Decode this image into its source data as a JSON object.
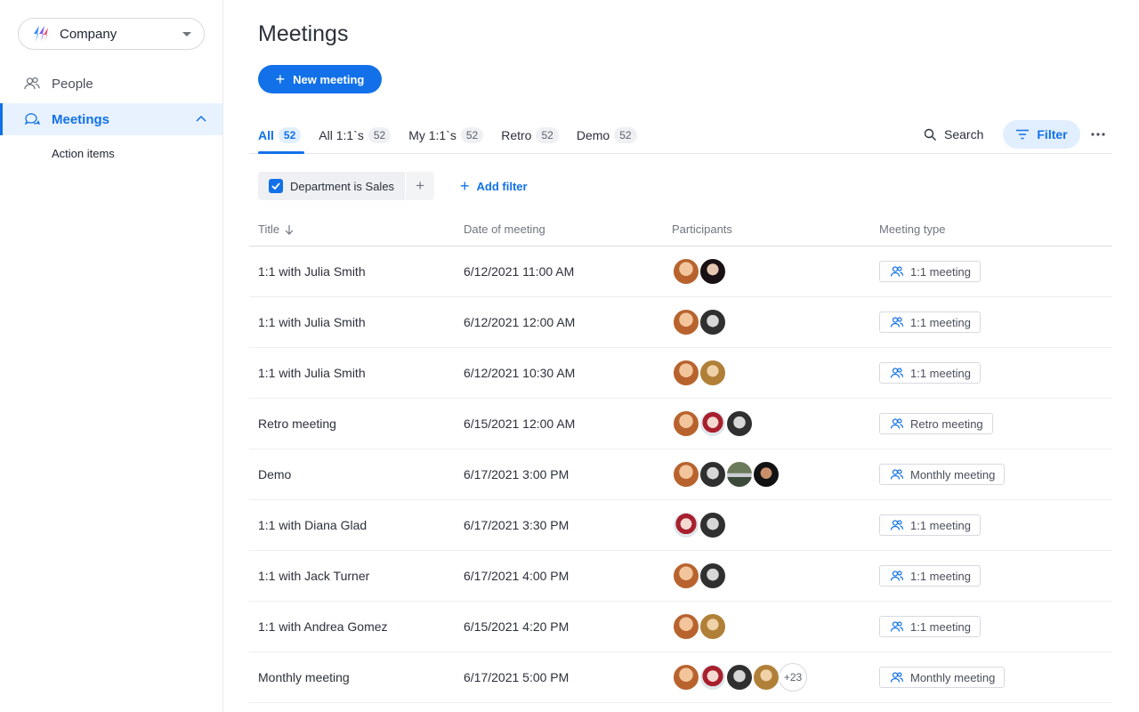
{
  "sidebar": {
    "company": "Company",
    "items": [
      {
        "label": "People",
        "icon": "people-icon"
      },
      {
        "label": "Meetings",
        "icon": "chat-bubbles-icon"
      }
    ],
    "sub_items": [
      {
        "label": "Action items"
      }
    ]
  },
  "header": {
    "title": "Meetings",
    "new_button": "New meeting"
  },
  "tabs": [
    {
      "label": "All",
      "count": "52"
    },
    {
      "label": "All 1:1`s",
      "count": "52"
    },
    {
      "label": "My 1:1`s",
      "count": "52"
    },
    {
      "label": "Retro",
      "count": "52"
    },
    {
      "label": "Demo",
      "count": "52"
    }
  ],
  "toolbar": {
    "search_label": "Search",
    "filter_label": "Filter"
  },
  "filters": {
    "active_chip": "Department is Sales",
    "add_filter": "Add filter"
  },
  "table": {
    "columns": [
      "Title",
      "Date of meeting",
      "Participants",
      "Meeting type"
    ],
    "rows": [
      {
        "title": "1:1 with Julia Smith",
        "date": "6/12/2021 11:00 AM",
        "participants": [
          "a",
          "b"
        ],
        "more": "",
        "type": "1:1 meeting"
      },
      {
        "title": "1:1 with Julia Smith",
        "date": "6/12/2021 12:00 AM",
        "participants": [
          "a",
          "c"
        ],
        "more": "",
        "type": "1:1 meeting"
      },
      {
        "title": "1:1 with Julia Smith",
        "date": "6/12/2021 10:30 AM",
        "participants": [
          "a",
          "d"
        ],
        "more": "",
        "type": "1:1 meeting"
      },
      {
        "title": "Retro meeting",
        "date": "6/15/2021 12:00 AM",
        "participants": [
          "a",
          "e",
          "c"
        ],
        "more": "",
        "type": "Retro meeting"
      },
      {
        "title": "Demo",
        "date": "6/17/2021 3:00 PM",
        "participants": [
          "a",
          "c",
          "f",
          "g"
        ],
        "more": "",
        "type": "Monthly meeting"
      },
      {
        "title": "1:1 with Diana Glad",
        "date": "6/17/2021 3:30 PM",
        "participants": [
          "e",
          "c"
        ],
        "more": "",
        "type": "1:1 meeting"
      },
      {
        "title": "1:1 with Jack Turner",
        "date": "6/17/2021 4:00 PM",
        "participants": [
          "a",
          "c"
        ],
        "more": "",
        "type": "1:1 meeting"
      },
      {
        "title": "1:1 with Andrea Gomez",
        "date": "6/15/2021 4:20 PM",
        "participants": [
          "a",
          "d"
        ],
        "more": "",
        "type": "1:1 meeting"
      },
      {
        "title": "Monthly meeting",
        "date": "6/17/2021 5:00 PM",
        "participants": [
          "a",
          "e",
          "c",
          "d"
        ],
        "more": "+23",
        "type": "Monthly meeting"
      }
    ]
  },
  "colors": {
    "accent": "#1271e8",
    "accent_light": "#e1eefd"
  }
}
